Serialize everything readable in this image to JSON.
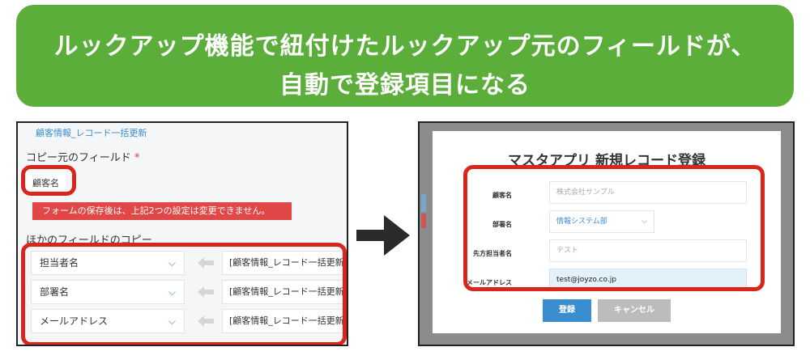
{
  "banner": {
    "line1": "ルックアップ機能で紐付けたルックアップ元のフィールドが、",
    "line2": "自動で登録項目になる"
  },
  "left_panel": {
    "link": "顧客情報_レコード一括更新",
    "copy_source_label": "コピー元のフィールド",
    "required_mark": "*",
    "copy_source_value": "顧客名",
    "warning": "フォームの保存後は、上記2つの設定は変更できません。",
    "other_copy_label": "ほかのフィールドのコピー",
    "mappings": [
      {
        "field": "担当者名",
        "source": "[顧客情報_レコード一括更新]先"
      },
      {
        "field": "部署名",
        "source": "[顧客情報_レコード一括更新]部"
      },
      {
        "field": "メールアドレス",
        "source": "[顧客情報_レコード一括更新]メ"
      }
    ]
  },
  "dialog": {
    "title": "マスタアプリ 新規レコード登録",
    "fields": [
      {
        "label": "顧客名",
        "placeholder": "株式会社サンプル"
      },
      {
        "label": "部署名",
        "value": "情報システム部"
      },
      {
        "label": "先方担当者名",
        "placeholder": "テスト"
      },
      {
        "label": "メールアドレス",
        "value": "test@joyzo.co.jp"
      }
    ],
    "save_label": "登録",
    "cancel_label": "キャンセル"
  },
  "colors": {
    "banner_green": "#5bae3a",
    "highlight_red": "#d9261c",
    "accent_blue": "#3b8ed0",
    "warning_red": "#e14747"
  },
  "icons": [
    "chevron-down-icon",
    "left-arrow-icon",
    "right-arrow-icon"
  ]
}
